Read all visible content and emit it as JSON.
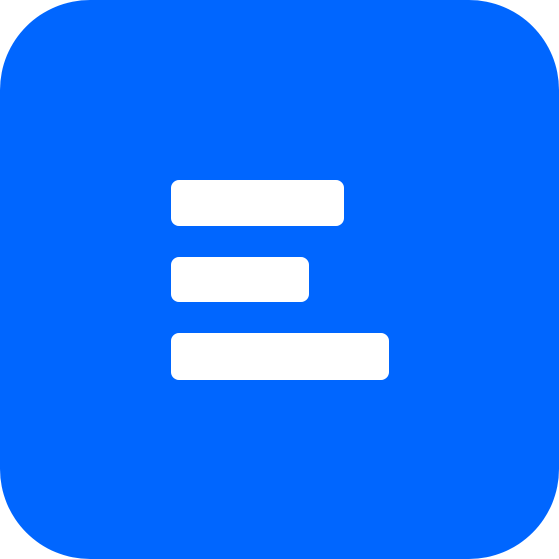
{
  "icon": {
    "name": "text-align-left-icon",
    "background_color": "#0066ff",
    "glyph_color": "#ffffff"
  }
}
